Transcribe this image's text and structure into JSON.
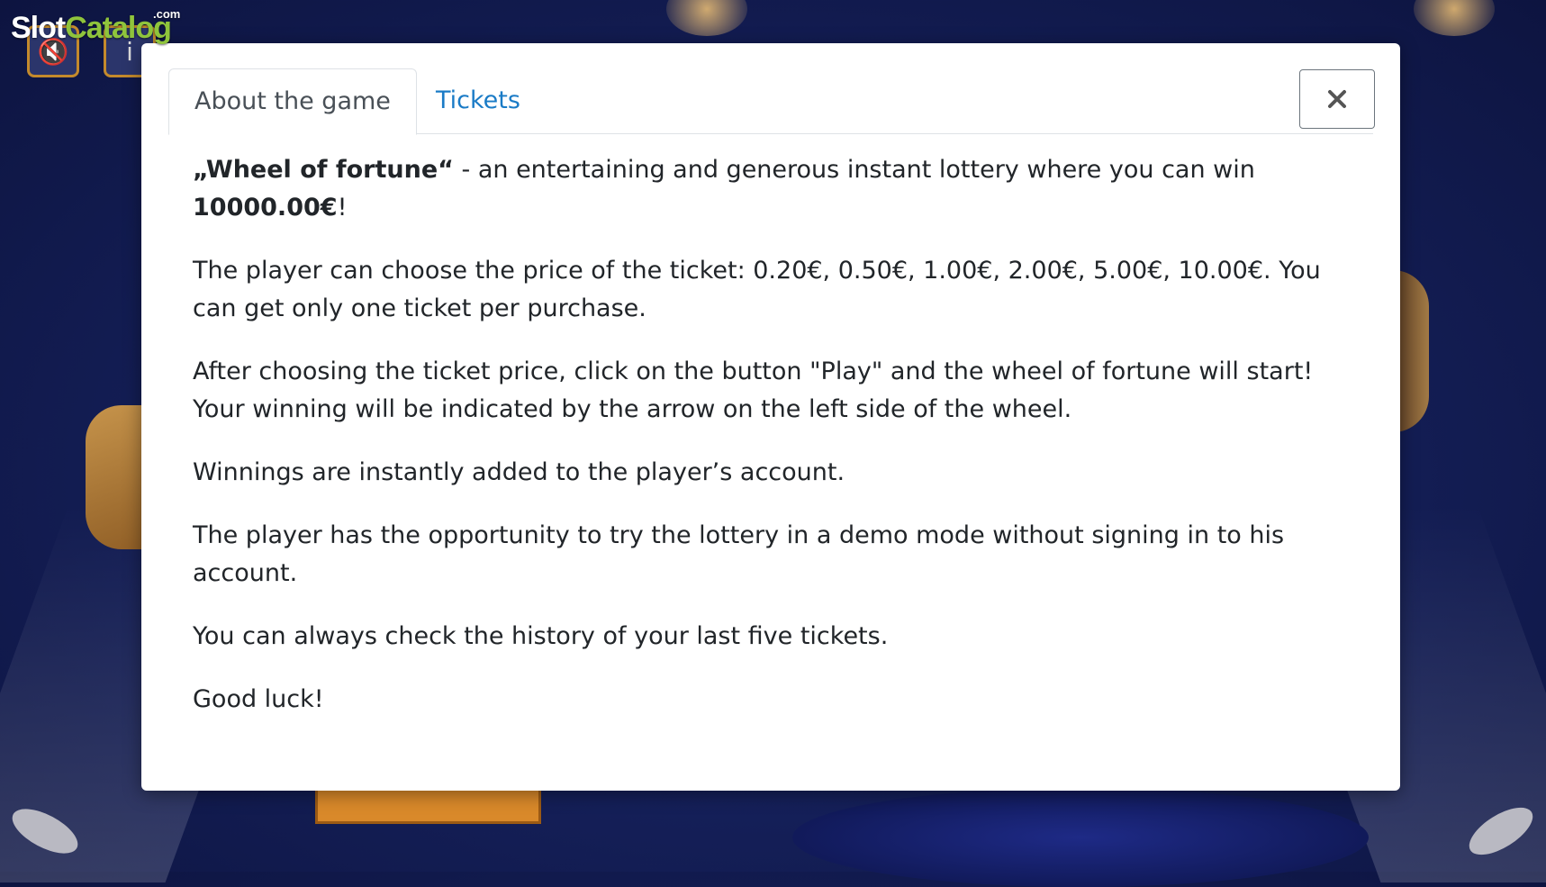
{
  "logo": {
    "slot": "Slot",
    "catalog": "Catalog",
    "com": ".com"
  },
  "background_icons": [
    "mute-icon",
    "info-icon"
  ],
  "modal": {
    "tabs": [
      {
        "label": "About the game",
        "active": true
      },
      {
        "label": "Tickets",
        "active": false
      }
    ],
    "close_icon": "close-icon",
    "intro": {
      "title": "„Wheel of fortune“",
      "text": " - an entertaining and generous instant lottery where you can win ",
      "amount": "10000.00€",
      "end": "!"
    },
    "paragraphs": [
      "The player can choose the price of the ticket: 0.20€, 0.50€, 1.00€, 2.00€, 5.00€, 10.00€. You can get only one ticket per purchase.",
      "After choosing the ticket price, click on the button \"Play\" and the wheel of fortune will start! Your winning will be indicated by the arrow on the left side of the wheel.",
      "Winnings are instantly added to the player’s account.",
      "The player has the opportunity to try the lottery in a demo mode without signing in to his account.",
      "You can always check the history of your last five tickets.",
      "Good luck!"
    ]
  },
  "colors": {
    "tab_link": "#1a7bc6",
    "logo_green": "#8fc43c",
    "background": "#15205a"
  }
}
